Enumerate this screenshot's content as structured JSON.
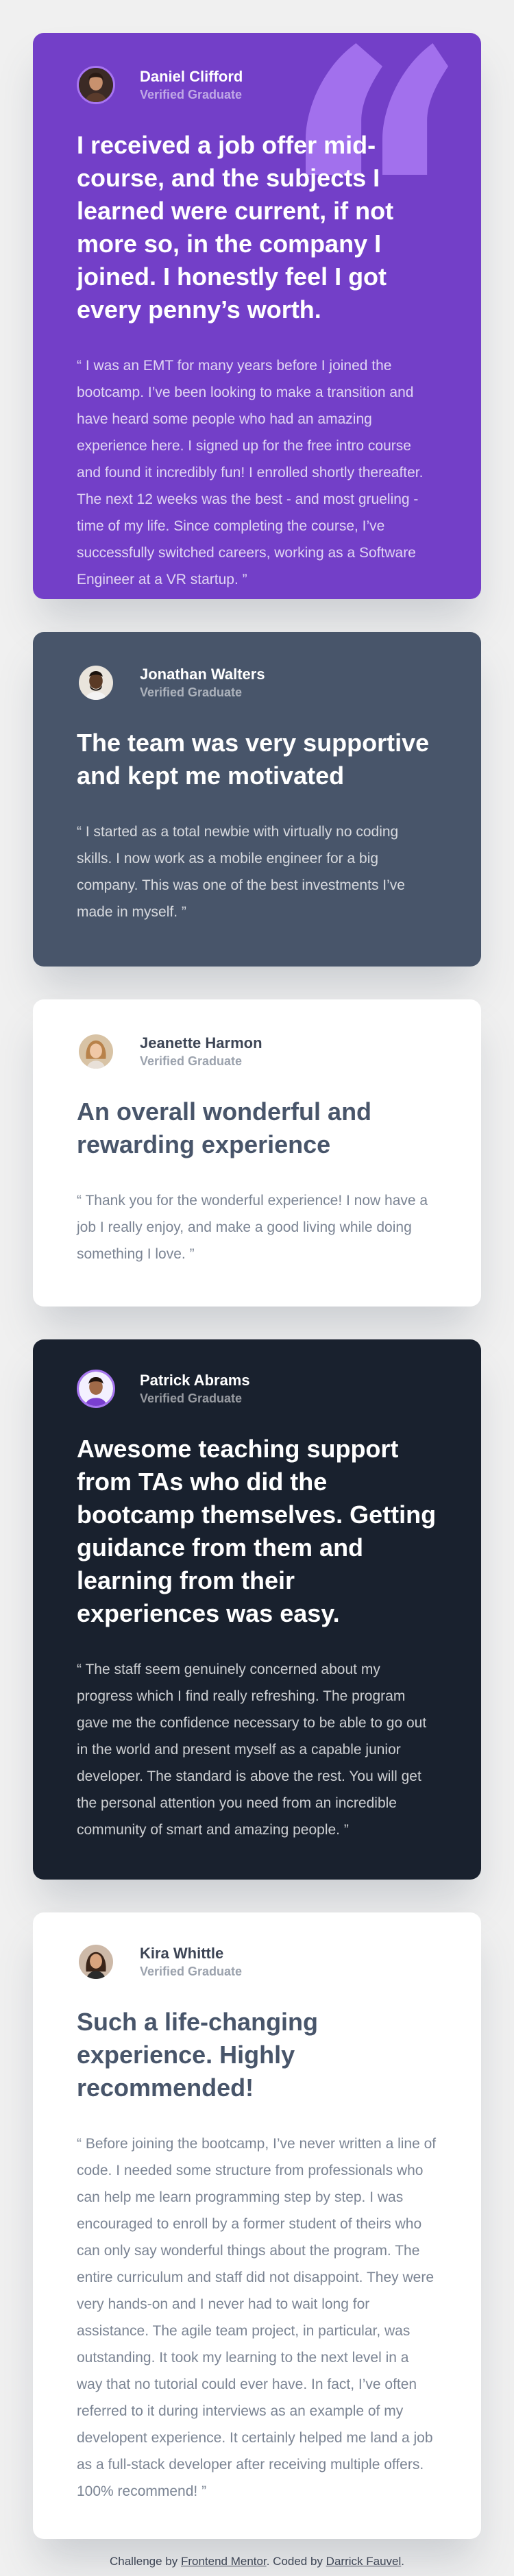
{
  "testimonials": [
    {
      "name": "Daniel Clifford",
      "status": "Verified Graduate",
      "headline": "I received a job offer mid-course, and the subjects I learned were current, if not more so, in the company I joined. I honestly feel I got every penny’s worth.",
      "body": "“ I was an EMT for many years before I joined the bootcamp. I’ve been looking to make a transition and have heard some people who had an amazing experience here. I signed up for the free intro course and found it incredibly fun! I enrolled shortly thereafter. The next 12 weeks was the best - and most grueling - time of my life. Since completing the course, I’ve successfully switched careers, working as a Software Engineer at a VR startup. ”"
    },
    {
      "name": "Jonathan Walters",
      "status": "Verified Graduate",
      "headline": "The team was very supportive and kept me motivated",
      "body": "“ I started as a total newbie with virtually no coding skills. I now work as a mobile engineer for a big company. This was one of the best investments I’ve made in myself. ”"
    },
    {
      "name": "Jeanette Harmon",
      "status": "Verified Graduate",
      "headline": "An overall wonderful and rewarding experience",
      "body": "“ Thank you for the wonderful experience! I now have a job I really enjoy, and make a good living while doing something I love. ”"
    },
    {
      "name": "Patrick Abrams",
      "status": "Verified Graduate",
      "headline": "Awesome teaching support from TAs who did the bootcamp themselves. Getting guidance from them and learning from their experiences was easy.",
      "body": "“ The staff seem genuinely concerned about my progress which I find really refreshing. The program gave me the confidence necessary to be able to go out in the world and present myself as a capable junior developer. The standard is above the rest. You will get the personal attention you need from an incredible community of smart and amazing people. ”"
    },
    {
      "name": "Kira Whittle",
      "status": "Verified Graduate",
      "headline": "Such a life-changing experience. Highly recommended!",
      "body": "“ Before joining the bootcamp, I’ve never written a line of code. I needed some structure from professionals who can help me learn programming step by step. I was encouraged to enroll by a former student of theirs who can only say wonderful things about the program. The entire curriculum and staff did not disappoint. They were very hands-on and I never had to wait long for assistance. The agile team project, in particular, was outstanding. It took my learning to the next level in a way that no tutorial could ever have. In fact, I’ve often referred to it during interviews as an example of my developent experience. It certainly helped me land a job as a full-stack developer after receiving multiple offers. 100% recommend! ”"
    }
  ],
  "footer": {
    "prefix": "Challenge by ",
    "challenge_link": "Frontend Mentor",
    "middle": ". Coded by ",
    "author_link": "Darrick Fauvel",
    "suffix": "."
  },
  "icons": {
    "quote": "quotation-mark-icon",
    "avatar": "avatar-photo"
  },
  "colors": {
    "moderate_violet": "#733fc8",
    "grayish_blue": "#48556a",
    "white": "#ffffff",
    "very_dark_blue": "#19212e",
    "background": "#f0f0f0",
    "avatar_border": "#a775f1"
  }
}
